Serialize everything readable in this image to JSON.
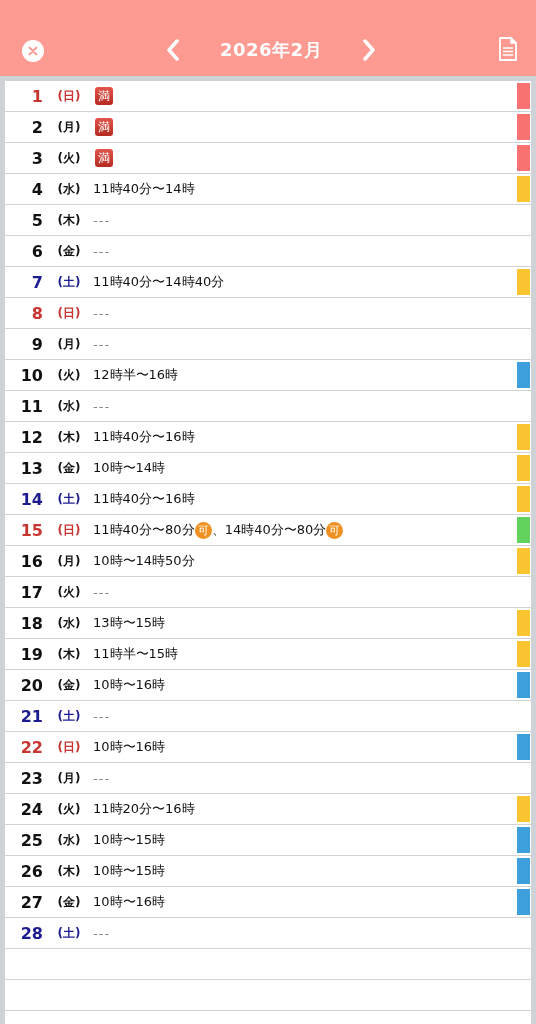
{
  "header": {
    "title": "2026年2月"
  },
  "days": [
    {
      "day": "1",
      "weekday": "(日)",
      "kind": "sun",
      "color": "#f87272",
      "schedule": [
        {
          "kind": "full",
          "text": "満"
        }
      ]
    },
    {
      "day": "2",
      "weekday": "(月)",
      "kind": "weekday",
      "color": "#f87272",
      "schedule": [
        {
          "kind": "full",
          "text": "満"
        }
      ]
    },
    {
      "day": "3",
      "weekday": "(火)",
      "kind": "weekday",
      "color": "#f87272",
      "schedule": [
        {
          "kind": "full",
          "text": "満"
        }
      ]
    },
    {
      "day": "4",
      "weekday": "(水)",
      "kind": "weekday",
      "color": "#fbc531",
      "schedule": [
        {
          "kind": "text",
          "text": "11時40分〜14時"
        }
      ]
    },
    {
      "day": "5",
      "weekday": "(木)",
      "kind": "weekday",
      "schedule": [
        {
          "kind": "none",
          "text": "---"
        }
      ]
    },
    {
      "day": "6",
      "weekday": "(金)",
      "kind": "weekday",
      "schedule": [
        {
          "kind": "none",
          "text": "---"
        }
      ]
    },
    {
      "day": "7",
      "weekday": "(土)",
      "kind": "sat",
      "color": "#fbc531",
      "schedule": [
        {
          "kind": "text",
          "text": "11時40分〜14時40分"
        }
      ]
    },
    {
      "day": "8",
      "weekday": "(日)",
      "kind": "sun",
      "schedule": [
        {
          "kind": "none",
          "text": "---"
        }
      ]
    },
    {
      "day": "9",
      "weekday": "(月)",
      "kind": "weekday",
      "schedule": [
        {
          "kind": "none",
          "text": "---"
        }
      ]
    },
    {
      "day": "10",
      "weekday": "(火)",
      "kind": "weekday",
      "color": "#3d9fdc",
      "schedule": [
        {
          "kind": "text",
          "text": "12時半〜16時"
        }
      ]
    },
    {
      "day": "11",
      "weekday": "(水)",
      "kind": "weekday",
      "schedule": [
        {
          "kind": "none",
          "text": "---"
        }
      ]
    },
    {
      "day": "12",
      "weekday": "(木)",
      "kind": "weekday",
      "color": "#fbc531",
      "schedule": [
        {
          "kind": "text",
          "text": "11時40分〜16時"
        }
      ]
    },
    {
      "day": "13",
      "weekday": "(金)",
      "kind": "weekday",
      "color": "#fbc531",
      "schedule": [
        {
          "kind": "text",
          "text": "10時〜14時"
        }
      ]
    },
    {
      "day": "14",
      "weekday": "(土)",
      "kind": "sat",
      "color": "#fbc531",
      "schedule": [
        {
          "kind": "text",
          "text": "11時40分〜16時"
        }
      ]
    },
    {
      "day": "15",
      "weekday": "(日)",
      "kind": "sun",
      "color": "#62d35c",
      "schedule": [
        {
          "kind": "text",
          "text": "11時40分〜80分"
        },
        {
          "kind": "ok",
          "text": "可"
        },
        {
          "kind": "text",
          "text": "、14時40分〜80分"
        },
        {
          "kind": "ok",
          "text": "可"
        }
      ]
    },
    {
      "day": "16",
      "weekday": "(月)",
      "kind": "weekday",
      "color": "#fbc531",
      "schedule": [
        {
          "kind": "text",
          "text": "10時〜14時50分"
        }
      ]
    },
    {
      "day": "17",
      "weekday": "(火)",
      "kind": "weekday",
      "schedule": [
        {
          "kind": "none",
          "text": "---"
        }
      ]
    },
    {
      "day": "18",
      "weekday": "(水)",
      "kind": "weekday",
      "color": "#fbc531",
      "schedule": [
        {
          "kind": "text",
          "text": "13時〜15時"
        }
      ]
    },
    {
      "day": "19",
      "weekday": "(木)",
      "kind": "weekday",
      "color": "#fbc531",
      "schedule": [
        {
          "kind": "text",
          "text": "11時半〜15時"
        }
      ]
    },
    {
      "day": "20",
      "weekday": "(金)",
      "kind": "weekday",
      "color": "#3d9fdc",
      "schedule": [
        {
          "kind": "text",
          "text": "10時〜16時"
        }
      ]
    },
    {
      "day": "21",
      "weekday": "(土)",
      "kind": "sat",
      "schedule": [
        {
          "kind": "none",
          "text": "---"
        }
      ]
    },
    {
      "day": "22",
      "weekday": "(日)",
      "kind": "sun",
      "color": "#3d9fdc",
      "schedule": [
        {
          "kind": "text",
          "text": "10時〜16時"
        }
      ]
    },
    {
      "day": "23",
      "weekday": "(月)",
      "kind": "weekday",
      "schedule": [
        {
          "kind": "none",
          "text": "---"
        }
      ]
    },
    {
      "day": "24",
      "weekday": "(火)",
      "kind": "weekday",
      "color": "#fbc531",
      "schedule": [
        {
          "kind": "text",
          "text": "11時20分〜16時"
        }
      ]
    },
    {
      "day": "25",
      "weekday": "(水)",
      "kind": "weekday",
      "color": "#3d9fdc",
      "schedule": [
        {
          "kind": "text",
          "text": "10時〜15時"
        }
      ]
    },
    {
      "day": "26",
      "weekday": "(木)",
      "kind": "weekday",
      "color": "#3d9fdc",
      "schedule": [
        {
          "kind": "text",
          "text": "10時〜15時"
        }
      ]
    },
    {
      "day": "27",
      "weekday": "(金)",
      "kind": "weekday",
      "color": "#3d9fdc",
      "schedule": [
        {
          "kind": "text",
          "text": "10時〜16時"
        }
      ]
    },
    {
      "day": "28",
      "weekday": "(土)",
      "kind": "sat",
      "schedule": [
        {
          "kind": "none",
          "text": "---"
        }
      ]
    }
  ]
}
